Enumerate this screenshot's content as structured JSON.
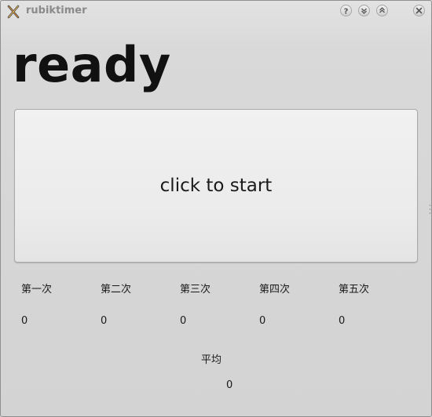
{
  "window": {
    "title": "rubiktimer",
    "buttons": {
      "help": "help-icon",
      "minimize": "chevron-down-icon",
      "maximize": "chevron-up-icon",
      "close": "close-icon"
    }
  },
  "status": "ready",
  "start_button": {
    "label": "click to start"
  },
  "attempts": [
    {
      "label": "第一次",
      "value": "0"
    },
    {
      "label": "第二次",
      "value": "0"
    },
    {
      "label": "第三次",
      "value": "0"
    },
    {
      "label": "第四次",
      "value": "0"
    },
    {
      "label": "第五次",
      "value": "0"
    }
  ],
  "average": {
    "label": "平均",
    "value": "0"
  },
  "colors": {
    "window_bg": "#d6d6d6",
    "heading": "#111111",
    "title_text": "#8a8a8a",
    "button_face": "#ebebeb"
  }
}
